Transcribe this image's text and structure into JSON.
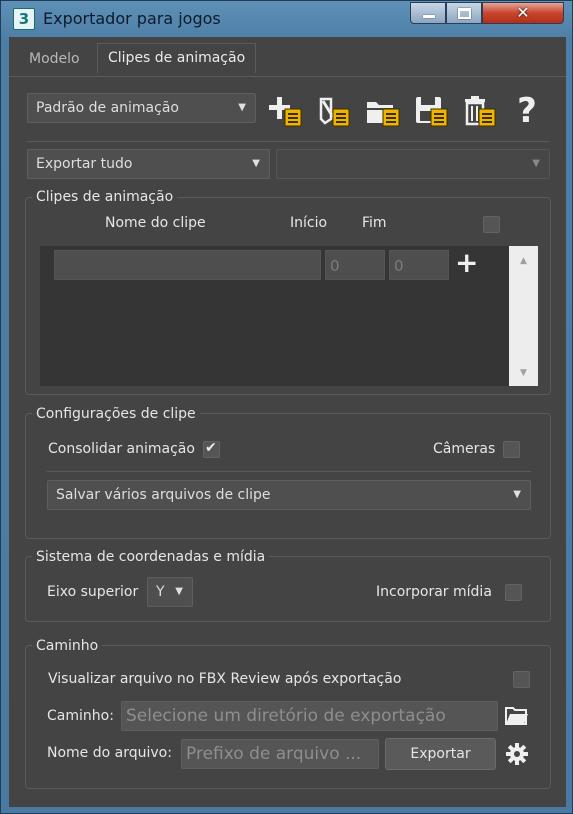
{
  "window": {
    "title": "Exportador para jogos",
    "app_icon_text": "3",
    "controls": {
      "minimize": "minimize-icon",
      "maximize": "maximize-icon",
      "close": "close-icon",
      "close_glyph": "✕"
    }
  },
  "tabs": [
    {
      "label": "Modelo",
      "active": false
    },
    {
      "label": "Clipes de animação",
      "active": true
    }
  ],
  "toolbar": {
    "preset_value": "Padrão de animação",
    "icons": [
      "add-preset-icon",
      "edit-preset-icon",
      "open-preset-icon",
      "save-preset-icon",
      "delete-preset-icon",
      "help-icon"
    ],
    "help_glyph": "?"
  },
  "export_scope": {
    "value": "Exportar tudo",
    "secondary_value": ""
  },
  "clips_group": {
    "title": "Clipes de animação",
    "headers": {
      "name": "Nome do clipe",
      "start": "Início",
      "end": "Fim"
    },
    "row": {
      "name": "",
      "start": "0",
      "end": "0"
    },
    "add_glyph": "+"
  },
  "clip_settings": {
    "title": "Configurações de clipe",
    "consolidate_label": "Consolidar animação",
    "consolidate_checked": true,
    "cameras_label": "Câmeras",
    "cameras_checked": false,
    "save_mode_value": "Salvar vários arquivos de clipe"
  },
  "coords": {
    "title": "Sistema de coordenadas e mídia",
    "up_axis_label": "Eixo superior",
    "up_axis_value": "Y",
    "embed_media_label": "Incorporar mídia",
    "embed_media_checked": false
  },
  "path": {
    "title": "Caminho",
    "view_fbx_label": "Visualizar arquivo no FBX Review após exportação",
    "view_fbx_checked": false,
    "path_label": "Caminho:",
    "path_placeholder": "Selecione um diretório de exportação",
    "filename_label": "Nome do arquivo:",
    "filename_placeholder": "Prefixo de arquivo ...",
    "export_button": "Exportar"
  },
  "colors": {
    "panel_bg": "#444444",
    "icon_accent": "#f0b400",
    "titlebar": "#5f90b6"
  }
}
